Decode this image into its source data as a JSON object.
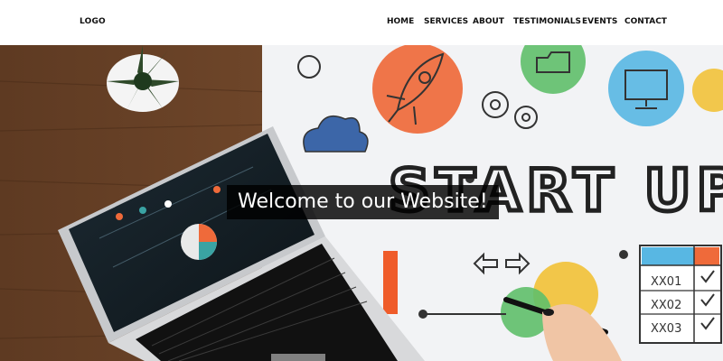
{
  "header": {
    "logo": "LOGO",
    "nav": [
      {
        "label": "HOME"
      },
      {
        "label": "SERVICES"
      },
      {
        "label": "ABOUT"
      },
      {
        "label": "TESTIMONIALS"
      },
      {
        "label": "EVENTS"
      },
      {
        "label": "CONTACT"
      }
    ]
  },
  "hero": {
    "welcome_text": "Welcome to our Website!",
    "whiteboard_title": "START UP",
    "checklist": [
      "XX01",
      "XX02",
      "XX03"
    ]
  }
}
